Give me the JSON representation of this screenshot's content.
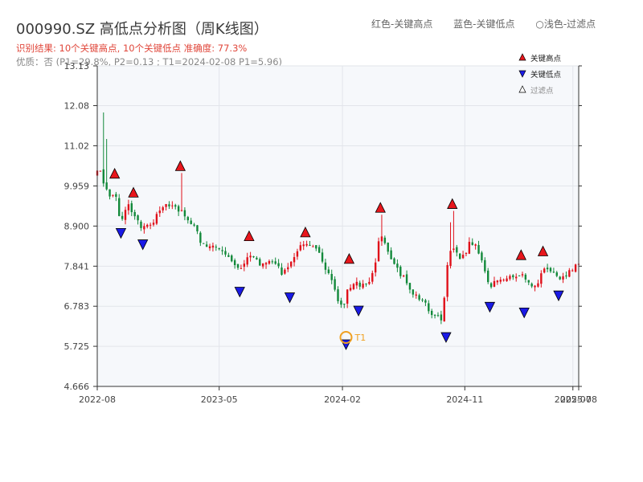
{
  "header": {
    "title": "000990.SZ 高低点分析图（周K线图）",
    "result": "识别结果: 10个关键高点, 10个关键低点   准确度: 77.3%",
    "quality": "优质：否  (P1=29.8%, P2=0.13 ; T1=2024-02-08 P1=5.96)"
  },
  "top_legend": {
    "red": "红色-关键高点",
    "blue": "蓝色-关键低点",
    "light": "○浅色-过滤点"
  },
  "colors": {
    "up": "#e0101a",
    "down": "#12893a",
    "high_marker": "#e8161c",
    "low_marker": "#1a1ae6",
    "t1": "#f0a020",
    "plot_bg": "#f6f8fb",
    "grid": "#e2e5ea"
  },
  "chart_data": {
    "type": "candlestick",
    "ylim": [
      4.666,
      13.13
    ],
    "xlim": [
      "2022-08-01",
      "2025-07-14"
    ],
    "yticks": [
      "4.666",
      "5.725",
      "6.783",
      "7.841",
      "8.900",
      "9.959",
      "11.02",
      "12.08",
      "13.13"
    ],
    "ytick_values": [
      4.666,
      5.725,
      6.783,
      7.841,
      8.9,
      9.959,
      11.02,
      12.08,
      13.13
    ],
    "xticks": [
      {
        "date": "2022-08-01",
        "label": "2022-08"
      },
      {
        "date": "2023-05-01",
        "label": "2023-05"
      },
      {
        "date": "2024-02-01",
        "label": "2024-02"
      },
      {
        "date": "2024-11-01",
        "label": "2024-11"
      },
      {
        "date": "2025-07-01",
        "label": "2025-07"
      },
      {
        "date": "2025-07-14",
        "label": "2025-08"
      }
    ],
    "legend": [
      "关键高点",
      "关键低点",
      "过滤点"
    ],
    "legend_position": "top-right",
    "grid": true,
    "price_path": [
      [
        "2022-08-05",
        10.2
      ],
      [
        "2022-08-12",
        10.6
      ],
      [
        "2022-08-19",
        10.1
      ],
      [
        "2022-08-26",
        9.85
      ],
      [
        "2022-09-09",
        9.7
      ],
      [
        "2022-09-16",
        9.95
      ],
      [
        "2022-09-23",
        9.2
      ],
      [
        "2022-10-07",
        9.1
      ],
      [
        "2022-10-14",
        9.45
      ],
      [
        "2022-10-28",
        9.3
      ],
      [
        "2022-11-11",
        8.95
      ],
      [
        "2022-11-25",
        8.8
      ],
      [
        "2022-12-09",
        9.0
      ],
      [
        "2022-12-23",
        9.3
      ],
      [
        "2023-01-13",
        9.45
      ],
      [
        "2023-01-27",
        9.4
      ],
      [
        "2023-02-10",
        9.3
      ],
      [
        "2023-02-24",
        9.1
      ],
      [
        "2023-03-10",
        8.95
      ],
      [
        "2023-03-24",
        8.6
      ],
      [
        "2023-04-07",
        8.3
      ],
      [
        "2023-04-21",
        8.35
      ],
      [
        "2023-05-05",
        8.25
      ],
      [
        "2023-05-19",
        8.15
      ],
      [
        "2023-06-02",
        8.0
      ],
      [
        "2023-06-16",
        7.7
      ],
      [
        "2023-06-30",
        7.9
      ],
      [
        "2023-07-14",
        8.15
      ],
      [
        "2023-07-28",
        8.0
      ],
      [
        "2023-08-11",
        7.9
      ],
      [
        "2023-08-25",
        7.95
      ],
      [
        "2023-09-08",
        7.9
      ],
      [
        "2023-09-22",
        7.7
      ],
      [
        "2023-10-06",
        7.7
      ],
      [
        "2023-10-20",
        8.1
      ],
      [
        "2023-11-03",
        8.4
      ],
      [
        "2023-11-17",
        8.35
      ],
      [
        "2023-12-01",
        8.3
      ],
      [
        "2023-12-15",
        8.2
      ],
      [
        "2023-12-29",
        7.9
      ],
      [
        "2024-01-12",
        7.6
      ],
      [
        "2024-01-26",
        7.0
      ],
      [
        "2024-02-09",
        6.8
      ],
      [
        "2024-02-23",
        7.3
      ],
      [
        "2024-03-08",
        7.35
      ],
      [
        "2024-03-22",
        7.3
      ],
      [
        "2024-04-05",
        7.4
      ],
      [
        "2024-04-19",
        7.7
      ],
      [
        "2024-05-03",
        8.8
      ],
      [
        "2024-05-17",
        8.4
      ],
      [
        "2024-05-31",
        7.9
      ],
      [
        "2024-06-14",
        7.7
      ],
      [
        "2024-06-28",
        7.5
      ],
      [
        "2024-07-12",
        7.2
      ],
      [
        "2024-07-26",
        7.0
      ],
      [
        "2024-08-09",
        6.9
      ],
      [
        "2024-08-23",
        6.6
      ],
      [
        "2024-09-06",
        6.55
      ],
      [
        "2024-09-20",
        6.45
      ],
      [
        "2024-09-27",
        7.8
      ],
      [
        "2024-10-11",
        8.4
      ],
      [
        "2024-10-25",
        8.0
      ],
      [
        "2024-11-08",
        8.2
      ],
      [
        "2024-11-22",
        8.5
      ],
      [
        "2024-12-06",
        8.3
      ],
      [
        "2024-12-20",
        7.8
      ],
      [
        "2025-01-03",
        7.3
      ],
      [
        "2025-01-17",
        7.4
      ],
      [
        "2025-01-31",
        7.55
      ],
      [
        "2025-02-14",
        7.6
      ],
      [
        "2025-02-28",
        7.55
      ],
      [
        "2025-03-14",
        7.6
      ],
      [
        "2025-03-28",
        7.45
      ],
      [
        "2025-04-11",
        7.2
      ],
      [
        "2025-04-25",
        7.55
      ],
      [
        "2025-05-09",
        7.8
      ],
      [
        "2025-05-23",
        7.75
      ],
      [
        "2025-06-06",
        7.55
      ],
      [
        "2025-06-20",
        7.6
      ],
      [
        "2025-07-04",
        7.75
      ],
      [
        "2025-07-11",
        7.9
      ]
    ],
    "spikes": [
      {
        "date": "2022-08-12",
        "high": 11.9
      },
      {
        "date": "2022-08-19",
        "high": 11.2
      },
      {
        "date": "2023-02-03",
        "high": 10.3
      },
      {
        "date": "2024-04-26",
        "high": 9.2
      },
      {
        "date": "2024-10-04",
        "high": 9.3
      },
      {
        "date": "2024-09-27",
        "high": 9.0
      }
    ],
    "key_highs": [
      {
        "date": "2022-09-09",
        "price": 10.1
      },
      {
        "date": "2022-10-21",
        "price": 9.6
      },
      {
        "date": "2023-02-03",
        "price": 10.3
      },
      {
        "date": "2023-07-07",
        "price": 8.45
      },
      {
        "date": "2023-11-10",
        "price": 8.55
      },
      {
        "date": "2024-02-16",
        "price": 7.85
      },
      {
        "date": "2024-04-26",
        "price": 9.2
      },
      {
        "date": "2024-10-04",
        "price": 9.3
      },
      {
        "date": "2025-03-07",
        "price": 7.95
      },
      {
        "date": "2025-04-25",
        "price": 8.05
      }
    ],
    "key_lows": [
      {
        "date": "2022-09-23",
        "price": 8.9
      },
      {
        "date": "2022-11-11",
        "price": 8.6
      },
      {
        "date": "2023-06-16",
        "price": 7.35
      },
      {
        "date": "2023-10-06",
        "price": 7.2
      },
      {
        "date": "2024-02-09",
        "price": 5.96
      },
      {
        "date": "2024-03-08",
        "price": 6.85
      },
      {
        "date": "2024-09-20",
        "price": 6.15
      },
      {
        "date": "2024-12-27",
        "price": 6.95
      },
      {
        "date": "2025-03-14",
        "price": 6.8
      },
      {
        "date": "2025-05-30",
        "price": 7.25
      }
    ],
    "t1": {
      "date": "2024-02-09",
      "price": 5.96,
      "label": "T1"
    }
  }
}
